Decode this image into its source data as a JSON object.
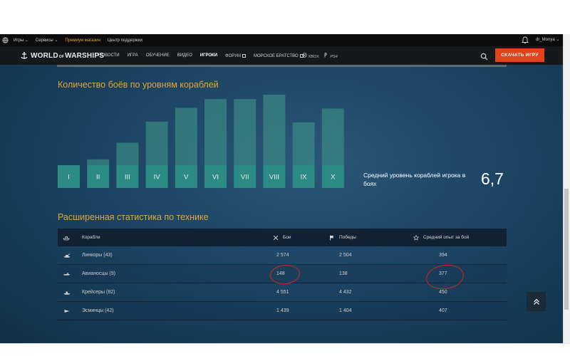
{
  "topbar": {
    "items": [
      "Игры",
      "Сервисы",
      "Премиум магазин",
      "Центр поддержки"
    ],
    "user": "dr_Monya"
  },
  "nav": {
    "logo_a": "WORLD",
    "logo_of": "OF",
    "logo_b": "WARSHIPS",
    "items": [
      "НОВОСТИ",
      "ИГРА",
      "ОБУЧЕНИЕ",
      "ВИДЕО",
      "ИГРОКИ",
      "ФОРУМ",
      "МОРСКОЕ БРАТСТВО"
    ],
    "active": "ИГРОКИ",
    "platform_xbox": "XBOX",
    "platform_ps": "PS4",
    "download": "СКАЧАТЬ ИГРУ"
  },
  "battles_by_tier": {
    "title": "Количество боёв по уровням кораблей",
    "avg_label": "Средний уровень кораблей игрока в боях",
    "avg_value": "6,7"
  },
  "chart_data": {
    "type": "bar",
    "categories": [
      "I",
      "II",
      "III",
      "IV",
      "V",
      "VI",
      "VII",
      "VIII",
      "IX",
      "X"
    ],
    "values": [
      0,
      8,
      31,
      60,
      79,
      91,
      91,
      97,
      59,
      78
    ],
    "ylim": [
      0,
      100
    ],
    "grid": false,
    "bar_color": "#2d8b85",
    "bar_color_dim": "#3c8a86"
  },
  "extended": {
    "title": "Расширенная статистика по технике",
    "headers": {
      "ships": "Корабли",
      "battles": "Бои",
      "wins": "Победы",
      "avg_exp": "Средний опыт за бой"
    },
    "rows": [
      {
        "icon": "battleship-icon",
        "name": "Линкоры (43)",
        "battles": "2 574",
        "wins": "2 504",
        "exp": "394"
      },
      {
        "icon": "aircraft-carrier-icon",
        "name": "Авианосцы (9)",
        "battles": "148",
        "wins": "138",
        "exp": "377"
      },
      {
        "icon": "cruiser-icon",
        "name": "Крейсеры (82)",
        "battles": "4 551",
        "wins": "4 432",
        "exp": "450"
      },
      {
        "icon": "destroyer-icon",
        "name": "Эсминцы (42)",
        "battles": "1 439",
        "wins": "1 404",
        "exp": "407"
      }
    ]
  },
  "colors": {
    "accent": "#e3a53a",
    "download_button": "#e3431a",
    "annotation": "#d7261c"
  }
}
